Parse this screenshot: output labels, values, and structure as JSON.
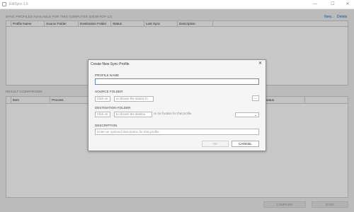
{
  "window": {
    "title": "EdiSync 1.6",
    "icon": "app-icon",
    "controls": {
      "minimize": "—",
      "maximize": "☐",
      "close": "✕"
    }
  },
  "profiles_section": {
    "label": "SYNC PROFILES AVAILABLE FOR THIS COMPUTER (DESKTOP-12)",
    "new_link": "New...",
    "delete_link": "Delete",
    "columns": [
      "Profile Name",
      "Source Folder",
      "Destination Folder",
      "Status",
      "Last Sync",
      "Description"
    ]
  },
  "result_section": {
    "label": "RESULT COMPARISON",
    "columns": [
      "Item",
      "Process",
      "Status"
    ]
  },
  "bottom_buttons": {
    "compare": "COMPARE",
    "sync": "SYNC"
  },
  "dialog": {
    "title": "Create New Sync Profile",
    "close": "✕",
    "profile_name": {
      "label": "PROFILE NAME",
      "value": ""
    },
    "source_folder": {
      "label": "SOURCE FOLDER",
      "click_hint": "Click on",
      "choose_hint": "to choose the source fo",
      "browse": "..."
    },
    "destination_folder": {
      "label": "DESTINATION FOLDER",
      "click_hint": "Click on",
      "choose_hint": "to choose the destina",
      "overflow_hint": "on for fixation for that profile",
      "dropdown_value": ""
    },
    "description": {
      "label": "DESCRIPTION",
      "placeholder": "Enter an optional description for that profile"
    },
    "ok": "OK",
    "cancel": "CANCEL"
  },
  "colors": {
    "accent": "#2b6cb0",
    "focus_border": "#4a90d9",
    "overlay": "rgba(0,0,0,0.22)"
  }
}
